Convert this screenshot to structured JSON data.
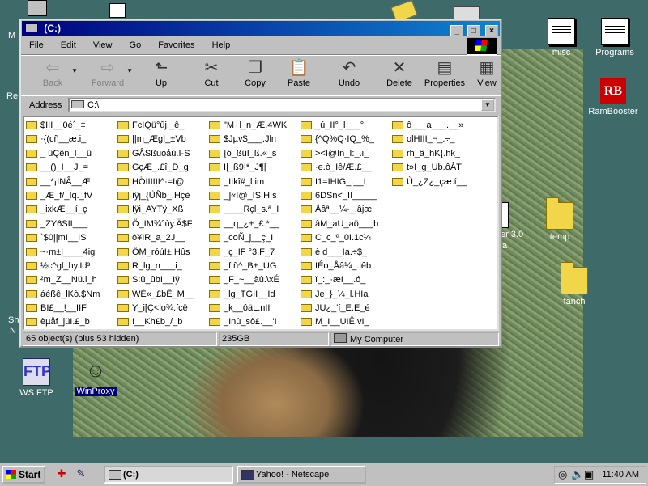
{
  "window": {
    "title": "(C:)",
    "buttons": {
      "minimize": "_",
      "maximize": "□",
      "close": "×"
    }
  },
  "menu": [
    "File",
    "Edit",
    "View",
    "Go",
    "Favorites",
    "Help"
  ],
  "toolbar": {
    "back": "Back",
    "forward": "Forward",
    "up": "Up",
    "cut": "Cut",
    "copy": "Copy",
    "paste": "Paste",
    "undo": "Undo",
    "delete": "Delete",
    "properties": "Properties",
    "views": "View"
  },
  "address": {
    "label": "Address",
    "value": "C:\\"
  },
  "files": [
    "$III__0é´_‡",
    "·{(cñ__æ.i_",
    "_ üÇên_I__ü",
    "__()_I__J_=",
    "__*¡INÂ__Æ",
    "_Æ_f/_Iq._fV",
    "_ixkÆ__í_ç",
    "_ZY6SII___",
    "`$0||mI__IS",
    "~·m±|____4ig",
    "½c^gl_hy.Id³",
    "²m_Z__Nü.l_h",
    "áéßê_lKò.$Nm",
    "BI£__!__IIF",
    "èµåf_jüI.£_b",
    "FcIQü°ûj._ê_",
    "||m_ÆgI_±Vb",
    "GÂSßuòåù.I-S",
    "GçÆ_.£î_D_g",
    "HÖIIIIII^·=I@",
    "íÿj_{ÜÑb_.Hçè",
    "Iÿi_AYTÿ_Xß",
    "Ö_IM¾°ùy.Ä$F",
    "ò¥IR_a_2J__",
    "ÖM_róúI±.Hûs",
    "R_lg_n___i_",
    "S:û_ûbI__Iÿ",
    "WÉ«_£bÊ_M__",
    "Y_i[Ç<lo¾.fcë",
    "!__Kh£b_/_b",
    "\"M+l_n_Æ.4WK",
    "$Jµv$___.Jln",
    "{ó_ßûI_ß.«_s",
    "I|_ß9I*_J¶|",
    "_IIkî#_l.im",
    "_]«I@_IS.HIs",
    "____Rçl_s.ª_I",
    "__q_¿±_£.*__",
    "_coÑ_j__ç_I",
    "_ç_IF °3.F_7",
    "_f|ñ^_B±_UG",
    "_F_~__àù.\\xÉ",
    "_lg_TGII__Id",
    "_k__ôäL.nII",
    "_Inù_sò£.__'I",
    "_ú_II°_l___°",
    "{^Q%Q·IQ_%_",
    "><I@In_I:_.i_",
    "·e.ò_Iê/Æ.£__",
    "I1=IHIG_.__I",
    "6DSn<_II_____",
    "Åâª__¼-_.âjæ",
    "âM_aU_aö___b",
    "C_c_º_0I.1c¼",
    "è d___Ia.÷$_",
    "IÉo_Åâ¼_.lêb",
    "ï_:_·æI__.ó_",
    "Je_}_¼_l.HIa",
    "JU¿_'í_E.E_é",
    "M_I__UIÊ.vI_",
    "ô___a___.__»",
    "olHIII_¬_.÷_",
    "rh_â_hK{.hk_",
    "t»I_g_Ub.ôÂT",
    "Ù_¿Z¿_çæ.í__"
  ],
  "status": {
    "objects": "65 object(s) (plus 53 hidden)",
    "size": "235GB",
    "location": "My Computer"
  },
  "desktop": {
    "misc": "misc",
    "programs": "Programs",
    "rambooster": "RamBooster",
    "ftp": "WS FTP",
    "winproxy": "WinProxy",
    "temp": "temp",
    "fanch": "fanch",
    "rb_logo": "RB",
    "ftp_logo": "FTP",
    "frag_left": [
      "M",
      "Re",
      "Sh",
      "N"
    ],
    "frag_right": [
      "er 3.0",
      "a"
    ]
  },
  "taskbar": {
    "start": "Start",
    "tasks": [
      "(C:)",
      "Yahoo! - Netscape"
    ],
    "clock": "11:40 AM"
  }
}
